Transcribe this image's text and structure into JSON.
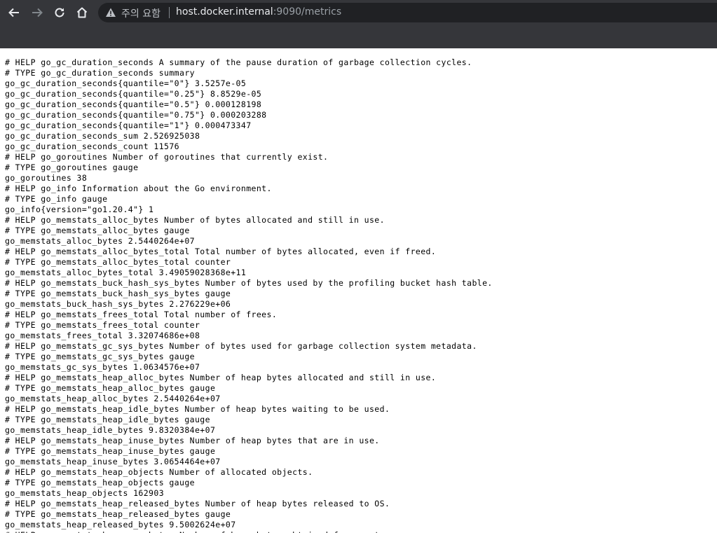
{
  "browser": {
    "security_label": "주의 요함",
    "url_host": "host.docker.internal",
    "url_rest": ":9090/metrics",
    "icons": {
      "back": "arrow-left-icon",
      "forward": "arrow-right-icon",
      "reload": "reload-icon",
      "home": "home-icon",
      "security": "warning-triangle-icon"
    }
  },
  "lines": [
    "# HELP go_gc_duration_seconds A summary of the pause duration of garbage collection cycles.",
    "# TYPE go_gc_duration_seconds summary",
    "go_gc_duration_seconds{quantile=\"0\"} 3.5257e-05",
    "go_gc_duration_seconds{quantile=\"0.25\"} 8.8529e-05",
    "go_gc_duration_seconds{quantile=\"0.5\"} 0.000128198",
    "go_gc_duration_seconds{quantile=\"0.75\"} 0.000203288",
    "go_gc_duration_seconds{quantile=\"1\"} 0.000473347",
    "go_gc_duration_seconds_sum 2.526925038",
    "go_gc_duration_seconds_count 11576",
    "# HELP go_goroutines Number of goroutines that currently exist.",
    "# TYPE go_goroutines gauge",
    "go_goroutines 38",
    "# HELP go_info Information about the Go environment.",
    "# TYPE go_info gauge",
    "go_info{version=\"go1.20.4\"} 1",
    "# HELP go_memstats_alloc_bytes Number of bytes allocated and still in use.",
    "# TYPE go_memstats_alloc_bytes gauge",
    "go_memstats_alloc_bytes 2.5440264e+07",
    "# HELP go_memstats_alloc_bytes_total Total number of bytes allocated, even if freed.",
    "# TYPE go_memstats_alloc_bytes_total counter",
    "go_memstats_alloc_bytes_total 3.49059028368e+11",
    "# HELP go_memstats_buck_hash_sys_bytes Number of bytes used by the profiling bucket hash table.",
    "# TYPE go_memstats_buck_hash_sys_bytes gauge",
    "go_memstats_buck_hash_sys_bytes 2.276229e+06",
    "# HELP go_memstats_frees_total Total number of frees.",
    "# TYPE go_memstats_frees_total counter",
    "go_memstats_frees_total 3.32074686e+08",
    "# HELP go_memstats_gc_sys_bytes Number of bytes used for garbage collection system metadata.",
    "# TYPE go_memstats_gc_sys_bytes gauge",
    "go_memstats_gc_sys_bytes 1.0634576e+07",
    "# HELP go_memstats_heap_alloc_bytes Number of heap bytes allocated and still in use.",
    "# TYPE go_memstats_heap_alloc_bytes gauge",
    "go_memstats_heap_alloc_bytes 2.5440264e+07",
    "# HELP go_memstats_heap_idle_bytes Number of heap bytes waiting to be used.",
    "# TYPE go_memstats_heap_idle_bytes gauge",
    "go_memstats_heap_idle_bytes 9.8320384e+07",
    "# HELP go_memstats_heap_inuse_bytes Number of heap bytes that are in use.",
    "# TYPE go_memstats_heap_inuse_bytes gauge",
    "go_memstats_heap_inuse_bytes 3.0654464e+07",
    "# HELP go_memstats_heap_objects Number of allocated objects.",
    "# TYPE go_memstats_heap_objects gauge",
    "go_memstats_heap_objects 162903",
    "# HELP go_memstats_heap_released_bytes Number of heap bytes released to OS.",
    "# TYPE go_memstats_heap_released_bytes gauge",
    "go_memstats_heap_released_bytes 9.5002624e+07",
    "# HELP go_memstats_heap_sys_bytes Number of heap bytes obtained from system."
  ]
}
